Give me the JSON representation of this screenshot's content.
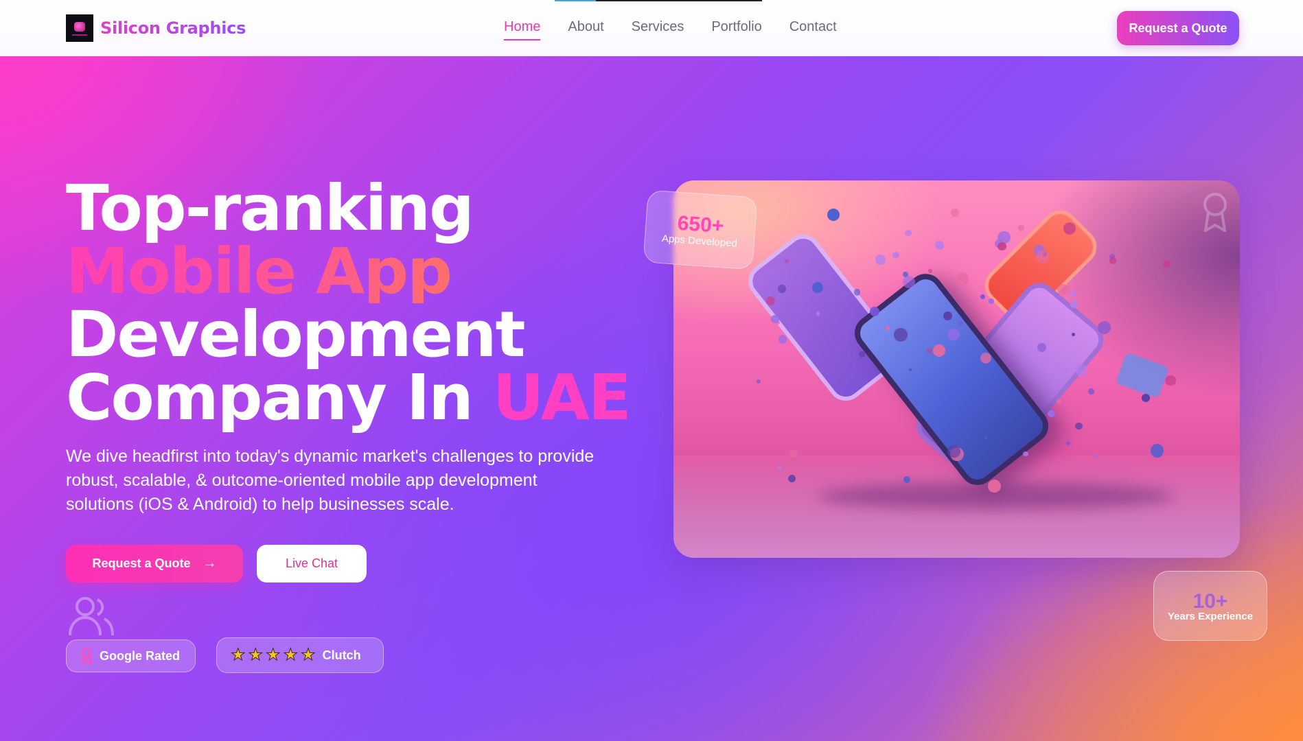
{
  "brand": {
    "name": "Silicon Graphics"
  },
  "nav": {
    "items": [
      {
        "label": "Home",
        "active": true
      },
      {
        "label": "About",
        "active": false
      },
      {
        "label": "Services",
        "active": false
      },
      {
        "label": "Portfolio",
        "active": false
      },
      {
        "label": "Contact",
        "active": false
      }
    ],
    "cta_label": "Request a Quote"
  },
  "hero": {
    "headline": {
      "line1": "Top-ranking",
      "line2": "Mobile App",
      "line3": "Development",
      "line4_a": "Company In ",
      "line4_b": "UAE"
    },
    "subtitle": "We dive headfirst into today's dynamic market's challenges to provide robust, scalable, & outcome-oriented mobile app development solutions (iOS & Android) to help businesses scale.",
    "primary_button": "Request a Quote",
    "secondary_button": "Live Chat",
    "badges": {
      "google": "Google Rated",
      "clutch": "Clutch",
      "clutch_stars": 5
    }
  },
  "stats": {
    "apps": {
      "value": "650+",
      "label": "Apps Developed"
    },
    "years": {
      "value": "10+",
      "label": "Years Experience"
    }
  },
  "icons": {
    "nav_arrow": "arrow-right-icon",
    "people": "users-icon",
    "award": "award-icon",
    "google_badge": "award-ribbon-icon",
    "star": "star-icon"
  },
  "colors": {
    "accent_pink": "#ff3fc4",
    "accent_purple": "#8a4df5",
    "accent_orange": "#ff8a3c"
  }
}
